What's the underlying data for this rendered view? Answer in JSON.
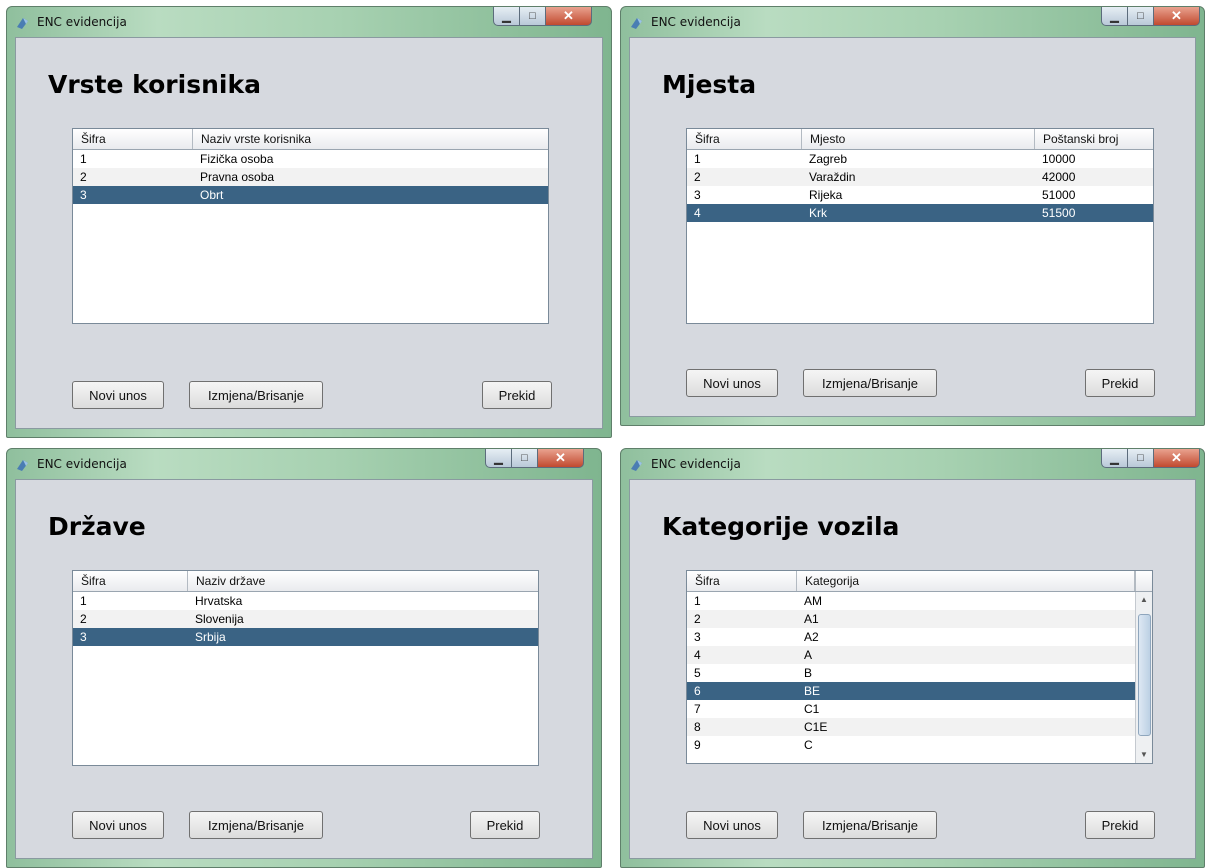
{
  "windows": [
    {
      "title": "ENC evidencija",
      "heading": "Vrste korisnika",
      "columns": [
        "Šifra",
        "Naziv vrste korisnika"
      ],
      "rows": [
        [
          "1",
          "Fizička osoba"
        ],
        [
          "2",
          "Pravna osoba"
        ],
        [
          "3",
          "Obrt"
        ]
      ],
      "selected_row": 3,
      "buttons": {
        "new": "Novi unos",
        "edit": "Izmjena/Brisanje",
        "cancel": "Prekid"
      }
    },
    {
      "title": "ENC evidencija",
      "heading": "Mjesta",
      "columns": [
        "Šifra",
        "Mjesto",
        "Poštanski broj"
      ],
      "rows": [
        [
          "1",
          "Zagreb",
          "10000"
        ],
        [
          "2",
          "Varaždin",
          "42000"
        ],
        [
          "3",
          "Rijeka",
          "51000"
        ],
        [
          "4",
          "Krk",
          "51500"
        ]
      ],
      "selected_row": 4,
      "buttons": {
        "new": "Novi unos",
        "edit": "Izmjena/Brisanje",
        "cancel": "Prekid"
      }
    },
    {
      "title": "ENC evidencija",
      "heading": "Države",
      "columns": [
        "Šifra",
        "Naziv države"
      ],
      "rows": [
        [
          "1",
          "Hrvatska"
        ],
        [
          "2",
          "Slovenija"
        ],
        [
          "3",
          "Srbija"
        ]
      ],
      "selected_row": 3,
      "buttons": {
        "new": "Novi unos",
        "edit": "Izmjena/Brisanje",
        "cancel": "Prekid"
      }
    },
    {
      "title": "ENC evidencija",
      "heading": "Kategorije vozila",
      "columns": [
        "Šifra",
        "Kategorija"
      ],
      "rows": [
        [
          "1",
          "AM"
        ],
        [
          "2",
          "A1"
        ],
        [
          "3",
          "A2"
        ],
        [
          "4",
          "A"
        ],
        [
          "5",
          "B"
        ],
        [
          "6",
          "BE"
        ],
        [
          "7",
          "C1"
        ],
        [
          "8",
          "C1E"
        ],
        [
          "9",
          "C"
        ]
      ],
      "selected_row": 6,
      "has_scrollbar": true,
      "buttons": {
        "new": "Novi unos",
        "edit": "Izmjena/Brisanje",
        "cancel": "Prekid"
      }
    }
  ],
  "icons": {
    "app": "app-icon",
    "minimize": "minimize-icon",
    "maximize": "maximize-icon",
    "close": "close-icon",
    "scroll_up": "scroll-up-icon",
    "scroll_down": "scroll-down-icon"
  },
  "colors": {
    "selection": "#3a6384",
    "client_bg": "#d6d9df",
    "frame": "#a7d1b1",
    "close_button": "#c14a2f"
  }
}
